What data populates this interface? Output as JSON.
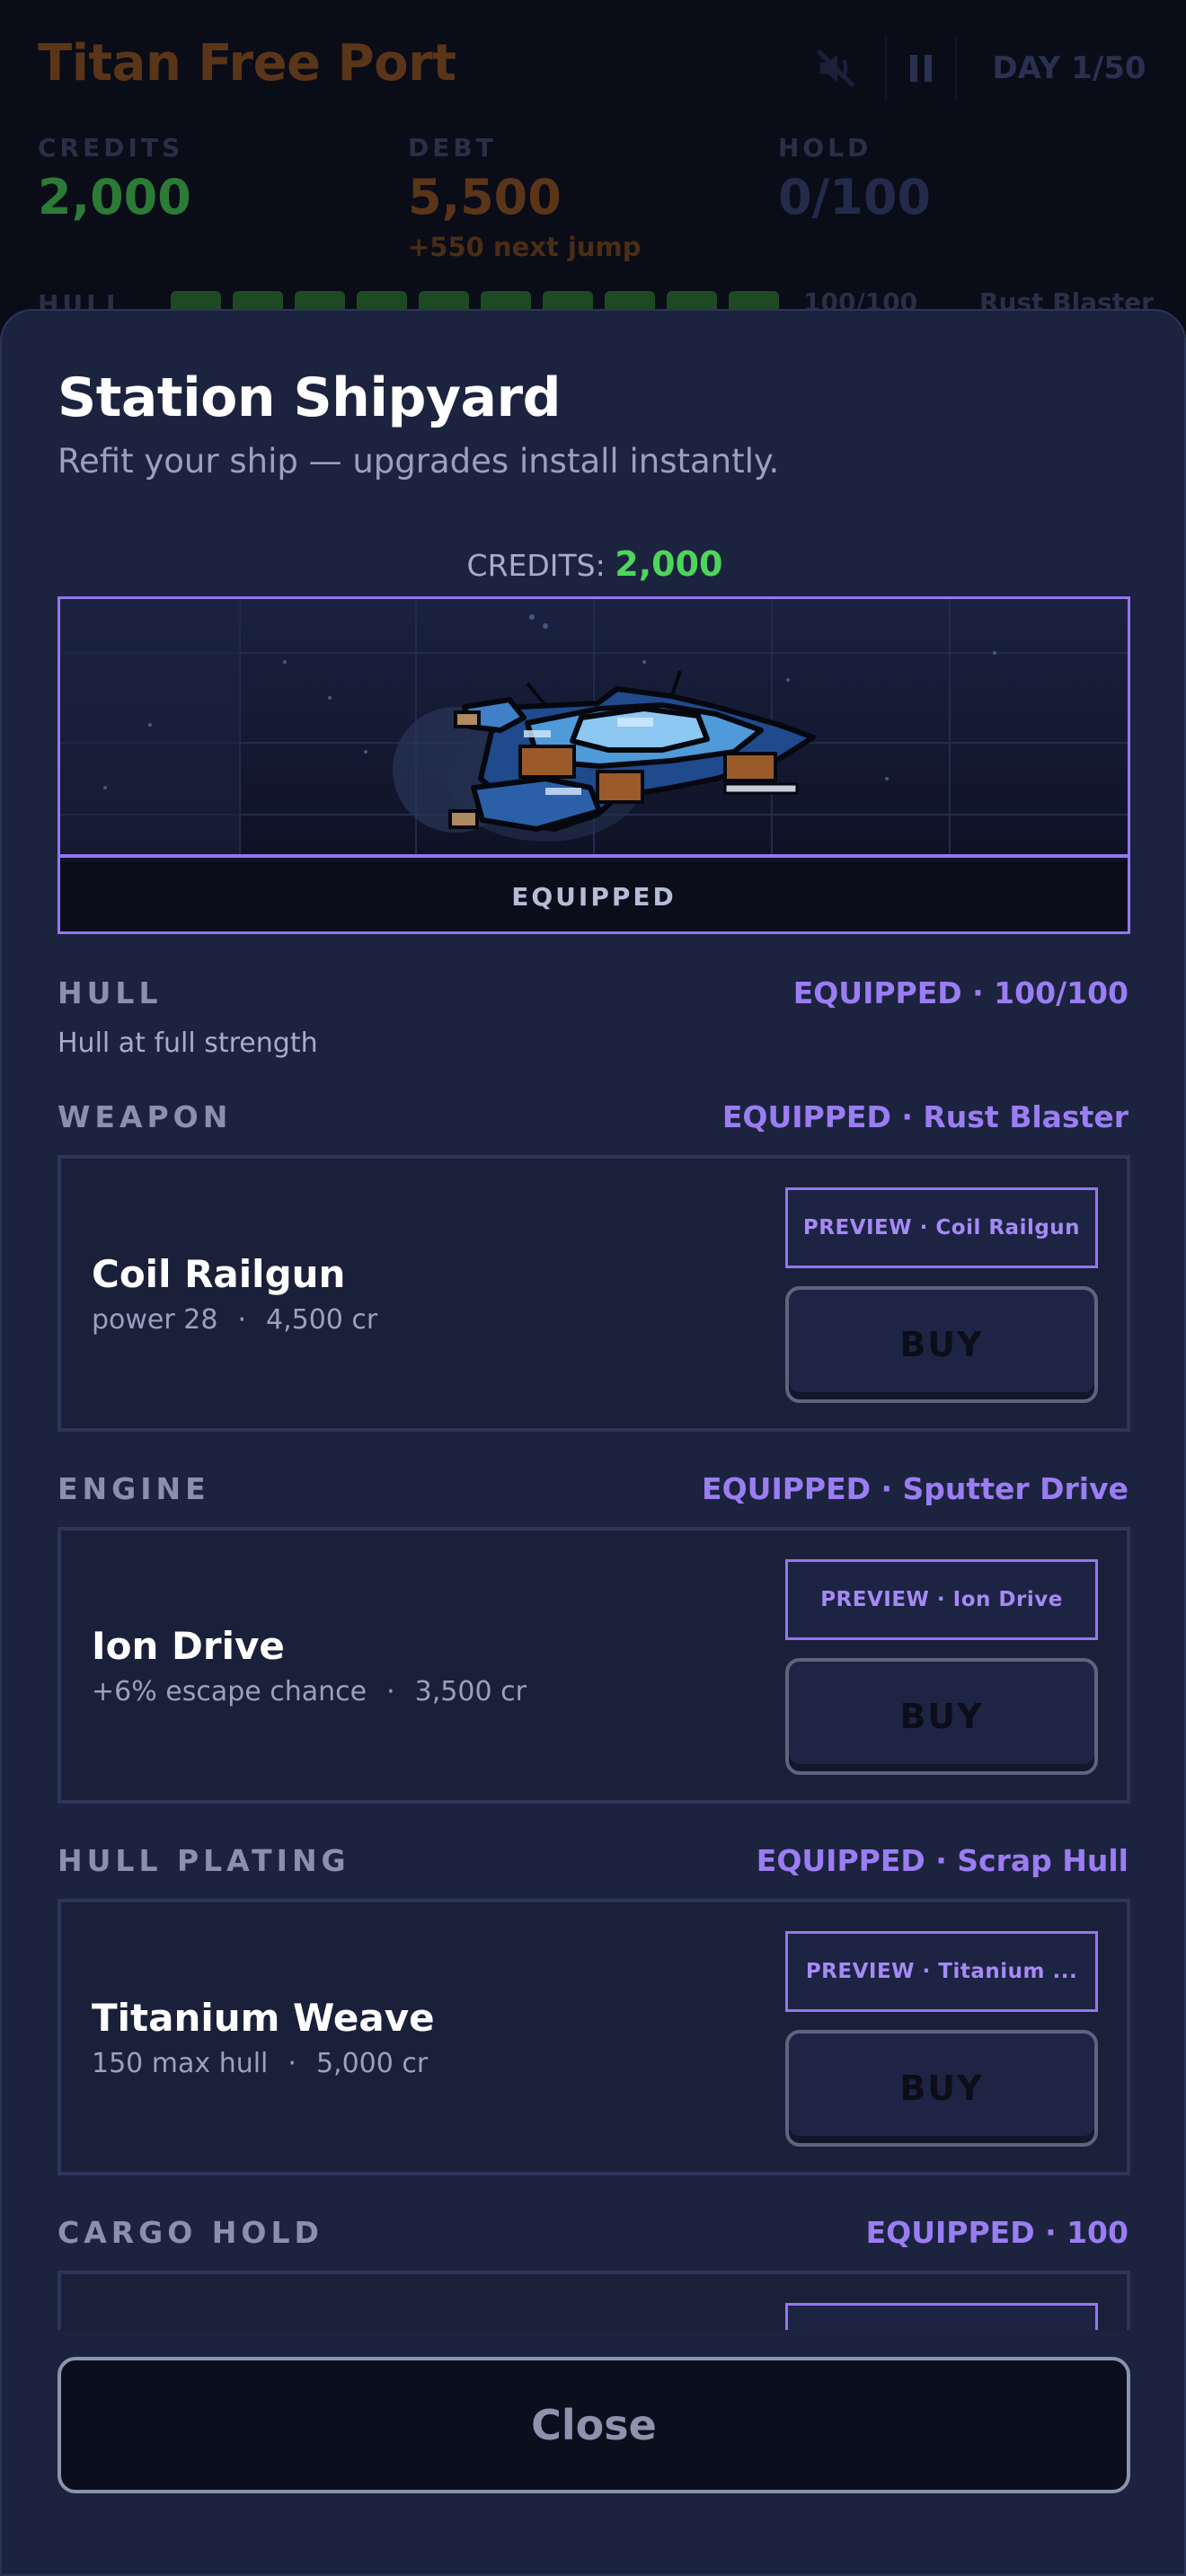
{
  "hud": {
    "station_name": "Titan Free Port",
    "day": "DAY 1/50",
    "sound_icon": "sound-muted-icon",
    "pause_icon": "pause-icon",
    "credits_label": "CREDITS",
    "credits_value": "2,000",
    "debt_label": "DEBT",
    "debt_value": "5,500",
    "debt_sub": "+550 next jump",
    "hold_label": "HOLD",
    "hold_value": "0/100",
    "hull_label": "HULL",
    "hull_fraction": 1.0,
    "hull_text": "100/100",
    "weapon_text": "Rust Blaster",
    "colors": {
      "credits": "#2b7a35",
      "debt": "#5a3518",
      "hold": "#232a4a"
    }
  },
  "modal": {
    "title": "Station Shipyard",
    "subtitle": "Refit your ship — upgrades install instantly.",
    "credits_label": "CREDITS:",
    "credits_value": "2,000",
    "preview_status": "EQUIPPED",
    "hull": {
      "label": "HULL",
      "status": "EQUIPPED · 100/100",
      "note": "Hull at full strength"
    },
    "sections": [
      {
        "label": "WEAPON",
        "status": "EQUIPPED · Rust Blaster",
        "item": {
          "name": "Coil Railgun",
          "stat": "power 28",
          "price": "4,500 cr",
          "preview": "PREVIEW · Coil Railgun",
          "buy": "BUY"
        }
      },
      {
        "label": "ENGINE",
        "status": "EQUIPPED · Sputter Drive",
        "item": {
          "name": "Ion Drive",
          "stat": "+6% escape chance",
          "price": "3,500 cr",
          "preview": "PREVIEW · Ion Drive",
          "buy": "BUY"
        }
      },
      {
        "label": "HULL PLATING",
        "status": "EQUIPPED · Scrap Hull",
        "item": {
          "name": "Titanium Weave",
          "stat": "150 max hull",
          "price": "5,000 cr",
          "preview": "PREVIEW · Titanium ...",
          "buy": "BUY"
        }
      },
      {
        "label": "CARGO HOLD",
        "status": "EQUIPPED · 100"
      }
    ],
    "meta_separator": "·",
    "close": "Close",
    "colors": {
      "accent": "#9576f0",
      "credits": "#4cd65a"
    }
  }
}
